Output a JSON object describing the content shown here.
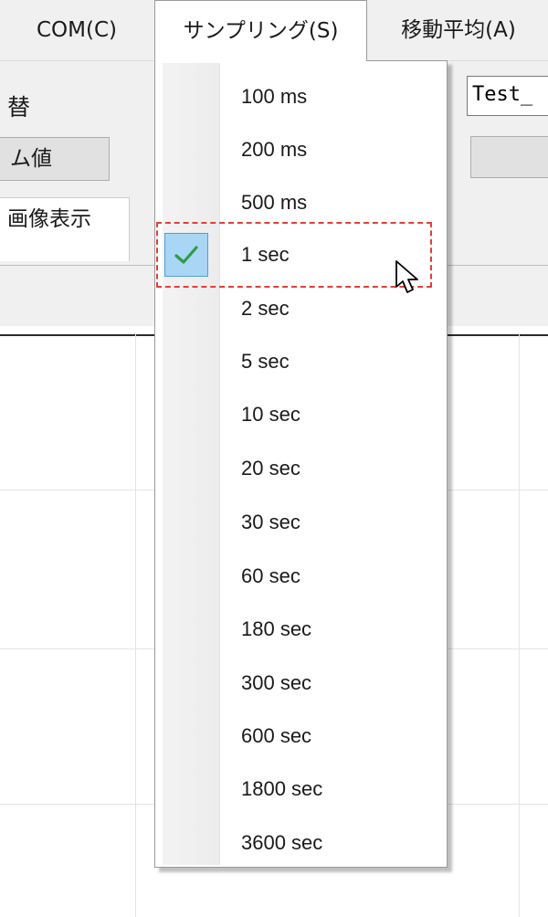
{
  "menubar": {
    "items": [
      {
        "label": "COM(C)"
      },
      {
        "label": "サンプリング(S)"
      },
      {
        "label": "移動平均(A)"
      }
    ]
  },
  "toolbar": {
    "label_top": "替",
    "button_label": "ム値",
    "tab_label": "画像表示",
    "filename_value": "Test_"
  },
  "sampling_menu": {
    "selected": "1 sec",
    "items": [
      {
        "label": "100 ms"
      },
      {
        "label": "200 ms"
      },
      {
        "label": "500 ms"
      },
      {
        "label": "1 sec",
        "checked": true
      },
      {
        "label": "2 sec"
      },
      {
        "label": "5 sec"
      },
      {
        "label": "10 sec"
      },
      {
        "label": "20 sec"
      },
      {
        "label": "30 sec"
      },
      {
        "label": "60 sec"
      },
      {
        "label": "180 sec"
      },
      {
        "label": "300 sec"
      },
      {
        "label": "600 sec"
      },
      {
        "label": "1800 sec"
      },
      {
        "label": "3600 sec"
      }
    ]
  },
  "icons": {
    "check": "checkmark-icon",
    "cursor": "mouse-pointer-icon"
  },
  "colors": {
    "check_green": "#2e9c47",
    "highlight_blue": "#a9d6f5",
    "focus_red": "#e0403a"
  }
}
